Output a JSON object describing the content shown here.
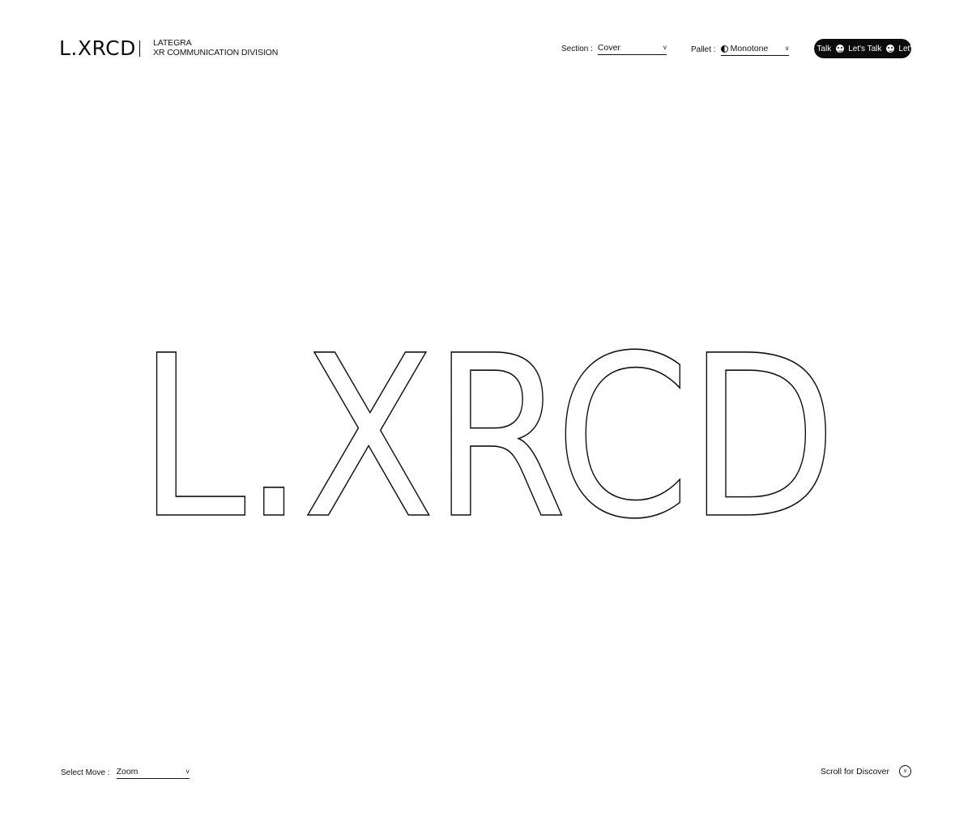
{
  "header": {
    "logo": "L.XRCD",
    "brand_line1": "LATEGRA",
    "brand_line2": "XR COMMUNICATION DIVISION",
    "section": {
      "label": "Section :",
      "value": "Cover"
    },
    "pallet": {
      "label": "Pallet :",
      "value": "Monotone",
      "icon": "half-circle-icon"
    },
    "talk_button": {
      "items": [
        "Let's Talk",
        "Let's Talk",
        "Let's Talk"
      ],
      "icon": "smiley-icon"
    }
  },
  "hero": {
    "title": "L.XRCD",
    "style": "outline"
  },
  "footer": {
    "move": {
      "label": "Select Move :",
      "value": "Zoom"
    },
    "scroll": {
      "label": "Scroll for Discover",
      "icon": "chevron-down-icon"
    }
  },
  "colors": {
    "background": "#ffffff",
    "foreground": "#111111",
    "pill": "#0b0b0b"
  }
}
